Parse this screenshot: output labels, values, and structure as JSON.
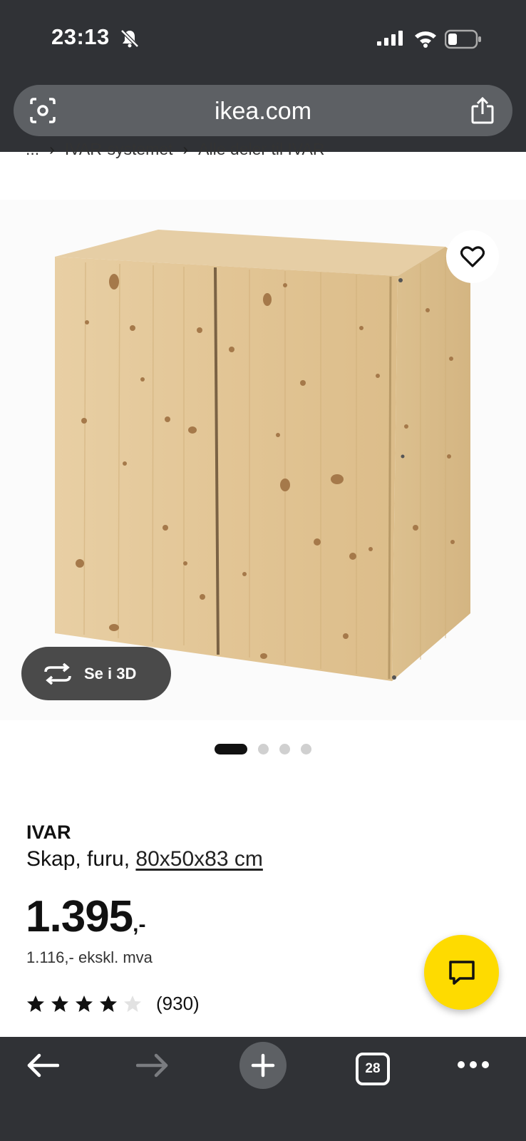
{
  "status": {
    "time": "23:13"
  },
  "browser": {
    "url": "ikea.com",
    "tab_count": "28"
  },
  "breadcrumb": {
    "items": [
      "...",
      "IVAR-systemet",
      "Alle deler til IVAR"
    ],
    "separator": "›"
  },
  "product": {
    "name": "IVAR",
    "desc_prefix": "Skap, furu, ",
    "dimensions": "80x50x83 cm",
    "price": "1.395",
    "price_suffix": ",-",
    "price_ex_vat": "1.116,- ekskl. mva",
    "rating": 4,
    "rating_max": 5,
    "review_count": "(930)",
    "view_3d_label": "Se i 3D"
  },
  "carousel": {
    "count": 4,
    "active": 0
  },
  "colors": {
    "chrome": "#303236",
    "urlbar": "#5d6064",
    "chat_yellow": "#fedb00",
    "wood": "#e3c79a"
  },
  "icons": [
    "bell-slash-icon",
    "signal-icon",
    "wifi-icon",
    "battery-icon",
    "camera-search-icon",
    "share-icon",
    "heart-icon",
    "rotate-3d-icon",
    "star-icon",
    "chat-icon",
    "back-arrow-icon",
    "forward-arrow-icon",
    "plus-icon",
    "tabs-icon",
    "more-icon"
  ]
}
